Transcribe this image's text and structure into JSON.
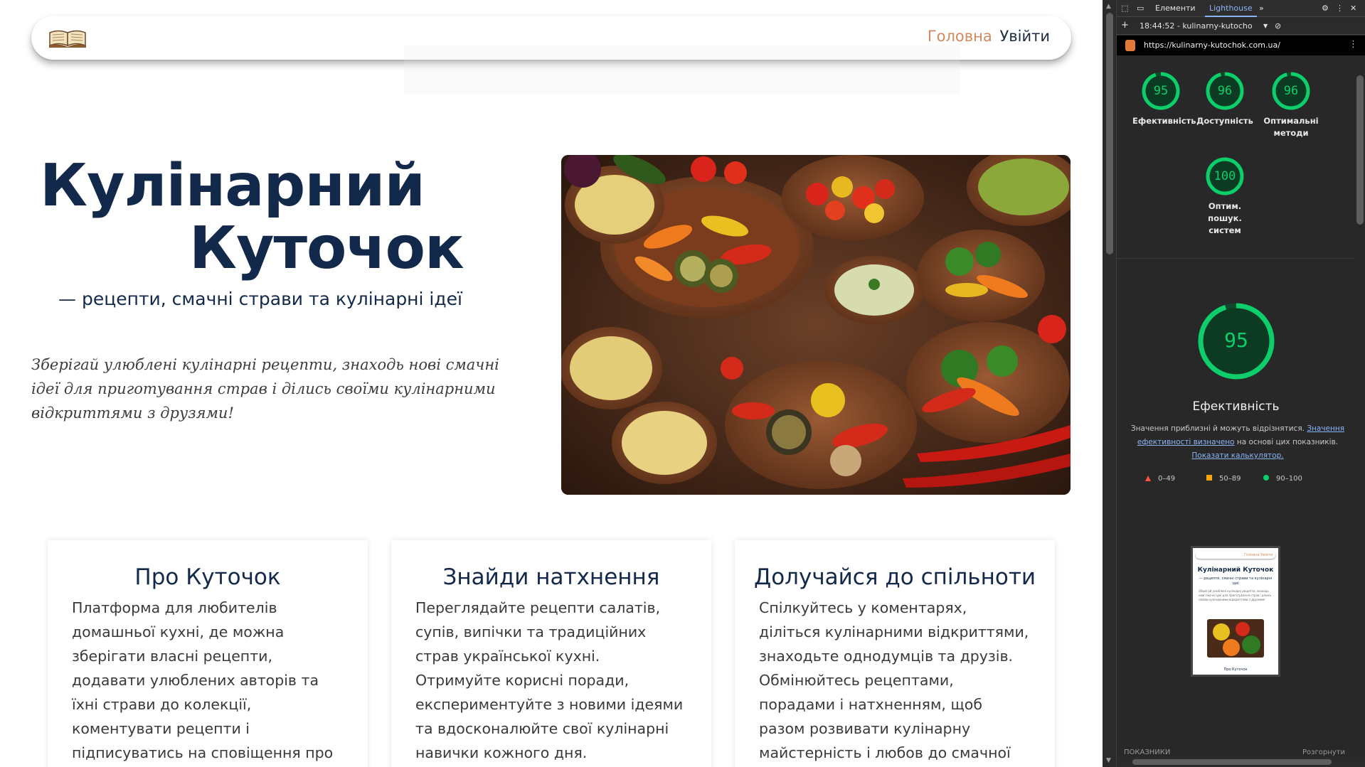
{
  "navbar": {
    "logo_icon": "open-book-icon",
    "home": "Головна",
    "login": "Увійти"
  },
  "hero": {
    "title_line1": "Кулінарний",
    "title_line2": "Куточок",
    "subtitle": "— рецепти, смачні страви та кулінарні ідеї",
    "description": "Зберігай улюблені кулінарні рецепти, знаходь нові смачні ідеї для приготування страв і ділись своїми кулінарними відкриттями з друзями!",
    "image_alt": "vegetables-and-grains-spread"
  },
  "cards": [
    {
      "title": "Про Куточок",
      "text": "Платформа для любителів домашньої кухні, де можна зберігати власні рецепти, додавати улюблених авторів та їхні страви до колекції, коментувати рецепти і підписуватись на сповіщення про нові смачні рецепти."
    },
    {
      "title": "Знайди натхнення",
      "text": "Переглядайте рецепти салатів, супів, випічки та традиційних страв української кухні. Отримуйте корисні поради, експериментуйте з новими ідеями та вдосконалюйте свої кулінарні навички кожного дня."
    },
    {
      "title": "Долучайся до спільноти",
      "text": "Спілкуйтесь у коментарях, діліться кулінарними відкриттями, знаходьте однодумців та друзів. Обмінюйтесь рецептами, порадами і натхненням, щоб разом розвивати кулінарну майстерність і любов до смачної їжі."
    }
  ],
  "devtools": {
    "tabs": [
      "Елементи",
      "Lighthouse"
    ],
    "active_tab": "Lighthouse",
    "report_time": "18:44:52 - kulinarny-kutocho",
    "url": "https://kulinarny-kutochok.com.ua/",
    "scores": [
      {
        "value": 95,
        "label": "Ефективність"
      },
      {
        "value": 96,
        "label": "Доступність"
      },
      {
        "value": 96,
        "label": "Оптимальні методи"
      },
      {
        "value": 100,
        "label": "Оптим. пошук. систем"
      }
    ],
    "main_score": 95,
    "main_label": "Ефективність",
    "note_prefix": "Значення приблизні й можуть відрізнятися. ",
    "note_link1": "Значення ефективності визначено",
    "note_mid": " на основі цих показників. ",
    "note_link2": "Показати калькулятор.",
    "legend": [
      "0–49",
      "50–89",
      "90–100"
    ],
    "thumbnail": {
      "nav": "Головна Увійти",
      "title": "Кулінарний Куточок",
      "subtitle": "— рецепти, смачні страви та кулінарні ідеї",
      "card": "Про Куточок"
    },
    "bottom_left": "ПОКАЗНИКИ",
    "bottom_right": "Розгорнути",
    "colors": {
      "pass": "#0cce6b",
      "average": "#ffa400",
      "fail": "#ff4e42",
      "link": "#8ab4f8"
    }
  }
}
